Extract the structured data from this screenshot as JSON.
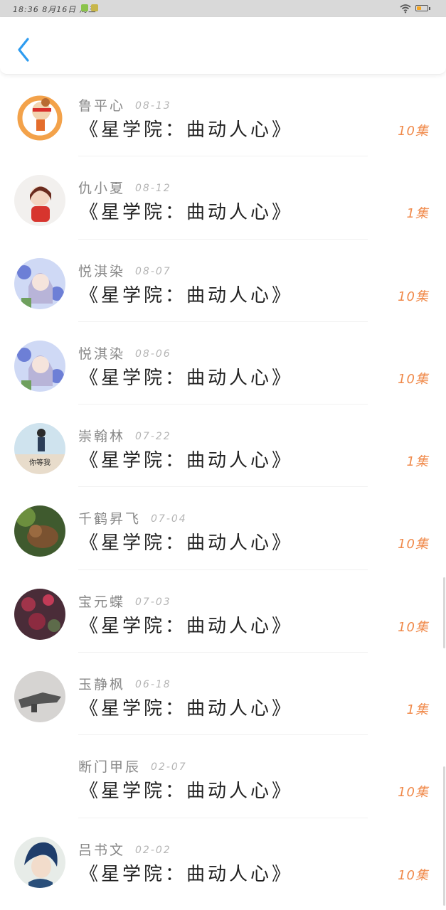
{
  "status_bar": {
    "time_text": "18:36 8月16日 周三"
  },
  "colors": {
    "accent": "#2e9cf0",
    "episode_color": "#f08a4b"
  },
  "items": [
    {
      "name": "鲁平心",
      "date": "08-13",
      "title": "《星学院：曲动人心》",
      "episodes": "10集"
    },
    {
      "name": "仇小夏",
      "date": "08-12",
      "title": "《星学院：曲动人心》",
      "episodes": "1集"
    },
    {
      "name": "悦淇染",
      "date": "08-07",
      "title": "《星学院：曲动人心》",
      "episodes": "10集"
    },
    {
      "name": "悦淇染",
      "date": "08-06",
      "title": "《星学院：曲动人心》",
      "episodes": "10集"
    },
    {
      "name": "崇翰林",
      "date": "07-22",
      "title": "《星学院：曲动人心》",
      "episodes": "1集",
      "avatar_caption": "你等我"
    },
    {
      "name": "千鹤昇飞",
      "date": "07-04",
      "title": "《星学院：曲动人心》",
      "episodes": "10集"
    },
    {
      "name": "宝元蝶",
      "date": "07-03",
      "title": "《星学院：曲动人心》",
      "episodes": "10集"
    },
    {
      "name": "玉静枫",
      "date": "06-18",
      "title": "《星学院：曲动人心》",
      "episodes": "1集"
    },
    {
      "name": "断门甲辰",
      "date": "02-07",
      "title": "《星学院：曲动人心》",
      "episodes": "10集"
    },
    {
      "name": "吕书文",
      "date": "02-02",
      "title": "《星学院：曲动人心》",
      "episodes": "10集"
    }
  ]
}
